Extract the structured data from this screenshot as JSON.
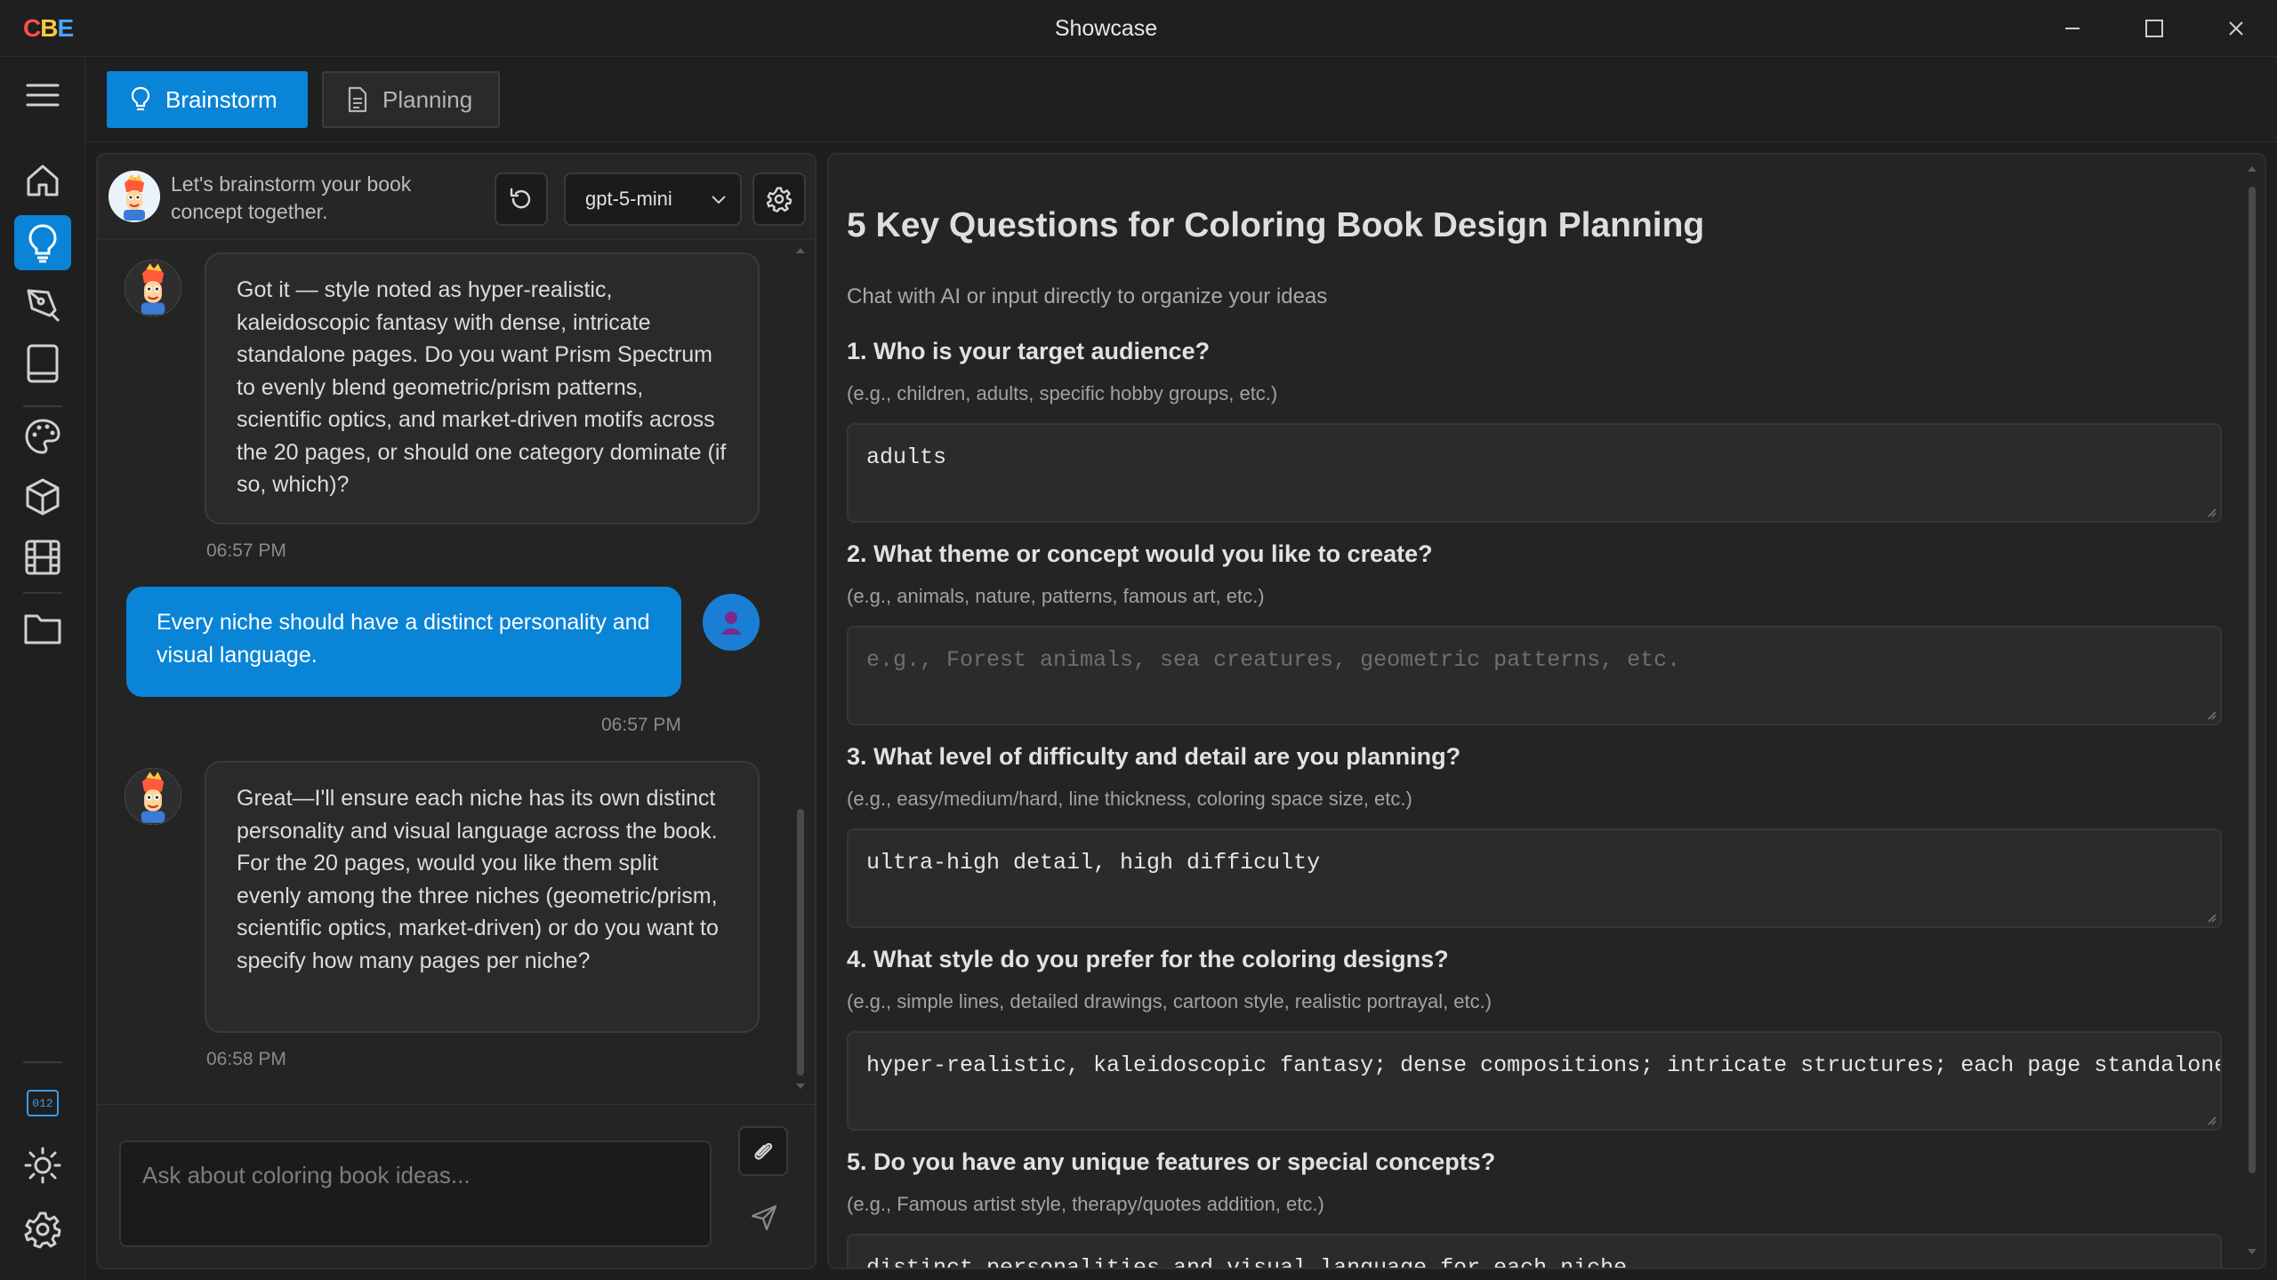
{
  "window": {
    "logo": {
      "c1": "C",
      "c2": "B",
      "c3": "E"
    },
    "title": "Showcase"
  },
  "tabs": [
    {
      "label": "Brainstorm",
      "icon": "lightbulb-icon",
      "active": true
    },
    {
      "label": "Planning",
      "icon": "document-icon",
      "active": false
    }
  ],
  "sidebar": {
    "items": [
      {
        "icon": "menu-icon"
      },
      {
        "icon": "home-icon"
      },
      {
        "icon": "lightbulb-icon",
        "active": true
      },
      {
        "icon": "pen-icon"
      },
      {
        "icon": "book-icon"
      },
      {
        "icon": "palette-icon"
      },
      {
        "icon": "box-icon"
      },
      {
        "icon": "film-icon"
      },
      {
        "icon": "folder-icon"
      },
      {
        "icon": "counter-icon",
        "text": "012"
      },
      {
        "icon": "theme-sun-icon"
      },
      {
        "icon": "settings-gear-icon"
      }
    ]
  },
  "chat": {
    "header_text": "Let's brainstorm your book concept together.",
    "model": "gpt-5-mini",
    "messages": [
      {
        "role": "assistant",
        "text": "Got it — style noted as hyper-realistic, kaleidoscopic fantasy with dense, intricate standalone pages. Do you want Prism Spectrum to evenly blend geometric/prism patterns, scientific optics, and market-driven motifs across the 20 pages, or should one category dominate (if so, which)?",
        "time": "06:57 PM"
      },
      {
        "role": "user",
        "text": "Every niche should have a distinct personality and visual language.",
        "time": "06:57 PM"
      },
      {
        "role": "assistant",
        "text": "Great—I'll ensure each niche has its own distinct personality and visual language across the book. For the 20 pages, would you like them split evenly among the three niches (geometric/prism, scientific optics, market-driven) or do you want to specify how many pages per niche?",
        "time": "06:58 PM"
      }
    ],
    "input_placeholder": "Ask about coloring book ideas..."
  },
  "planning": {
    "title": "5 Key Questions for Coloring Book Design Planning",
    "subtitle": "Chat with AI or input directly to organize your ideas",
    "questions": [
      {
        "label": "1. Who is your target audience?",
        "hint": "(e.g., children, adults, specific hobby groups, etc.)",
        "value": "adults",
        "placeholder": ""
      },
      {
        "label": "2. What theme or concept would you like to create?",
        "hint": "(e.g., animals, nature, patterns, famous art, etc.)",
        "value": "",
        "placeholder": "e.g., Forest animals, sea creatures, geometric patterns, etc."
      },
      {
        "label": "3. What level of difficulty and detail are you planning?",
        "hint": "(e.g., easy/medium/hard, line thickness, coloring space size, etc.)",
        "value": "ultra-high detail, high difficulty",
        "placeholder": ""
      },
      {
        "label": "4. What style do you prefer for the coloring designs?",
        "hint": "(e.g., simple lines, detailed drawings, cartoon style, realistic portrayal, etc.)",
        "value": "hyper-realistic, kaleidoscopic fantasy; dense compositions; intricate structures; each page standalone",
        "placeholder": ""
      },
      {
        "label": "5. Do you have any unique features or special concepts?",
        "hint": "(e.g., Famous artist style, therapy/quotes addition, etc.)",
        "value": "distinct personalities and visual language for each niche",
        "placeholder": ""
      }
    ]
  },
  "colors": {
    "accent": "#0a84d6",
    "background": "#1e1e1e",
    "panel": "#242424"
  }
}
